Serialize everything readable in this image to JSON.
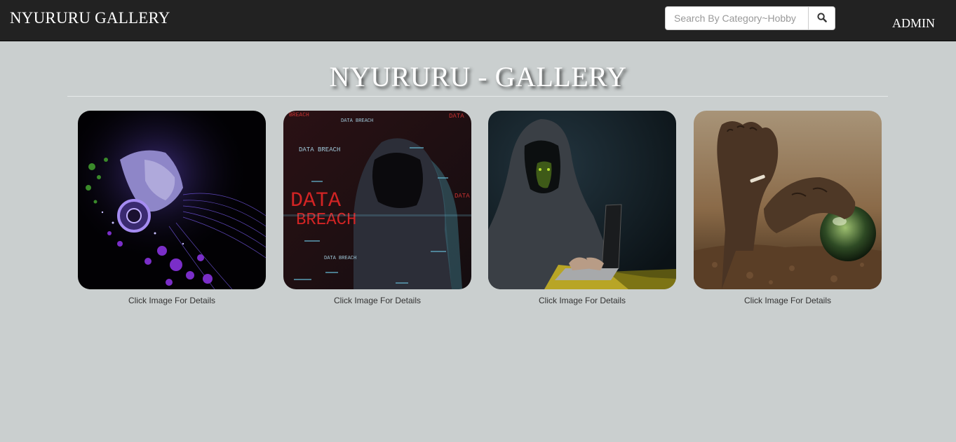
{
  "navbar": {
    "brand": "NYURURU GALLERY",
    "search": {
      "placeholder": "Search By Category~Hobby",
      "value": ""
    },
    "search_icon": "search-icon",
    "admin_label": "ADMIN"
  },
  "main": {
    "title": "NYURURU - GALLERY",
    "cards": [
      {
        "caption": "Click Image For Details",
        "image": "headphone-woman-art"
      },
      {
        "caption": "Click Image For Details",
        "image": "data-breach-hacker",
        "overlay_texts": [
          "DATA",
          "BREACH",
          "DATA BREACH"
        ]
      },
      {
        "caption": "Click Image For Details",
        "image": "hooded-hacker-laptop"
      },
      {
        "caption": "Click Image For Details",
        "image": "hands-glass-sphere"
      }
    ]
  },
  "colors": {
    "navbar_bg": "#222222",
    "page_bg": "#cacfcf",
    "title_text": "#ffffff"
  }
}
